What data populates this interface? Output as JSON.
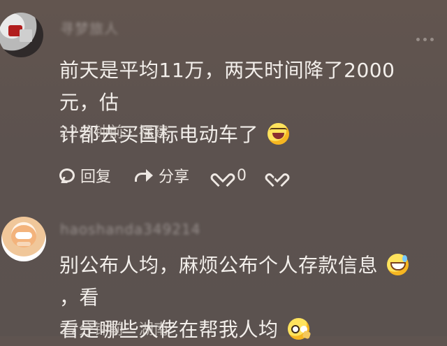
{
  "comments": [
    {
      "username": "寻梦旅人",
      "text_lines": [
        "前天是平均11万，两天时间降了2000元，估",
        "计都去买国标电动车了"
      ],
      "emoji": "rolling-laughing-emoji",
      "meta": "22分钟前 · 福建",
      "actions": {
        "reply_label": "回复",
        "share_label": "分享",
        "like_count": "0"
      }
    },
    {
      "username": "haoshanda349214",
      "text_lines": [
        "别公布人均，麻烦公布个人存款信息",
        "，看",
        "看是哪些大佬在帮我人均"
      ],
      "emoji_1": "sweat-smile-emoji",
      "emoji_2": "thinking-emoji",
      "meta": "27分钟前 · 湖南"
    }
  ],
  "colors": {
    "background": "#5f5450",
    "text": "#f3efeb",
    "meta": "#e6e0db",
    "emoji_yellow": "#ffe35d"
  }
}
